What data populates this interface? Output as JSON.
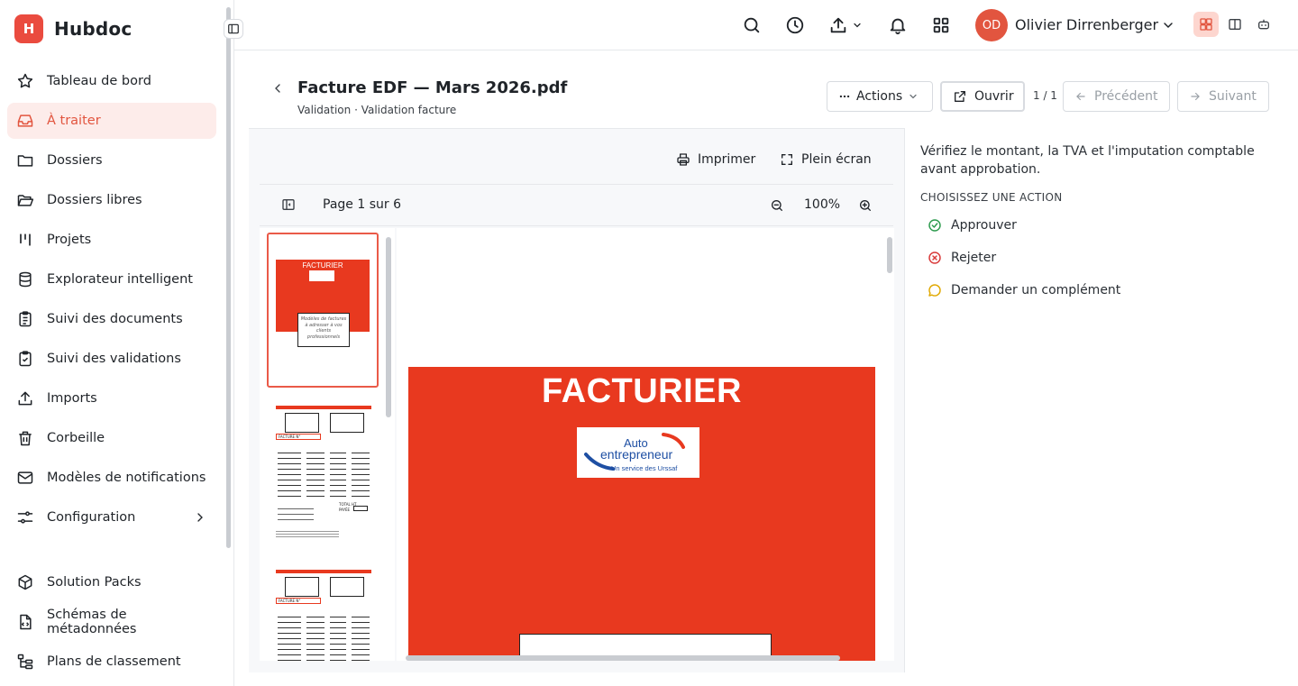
{
  "app": {
    "name": "Hubdoc",
    "logo_letter": "H"
  },
  "sidebar": {
    "items": [
      {
        "label": "Tableau de bord",
        "icon": "star-icon"
      },
      {
        "label": "À traiter",
        "icon": "inbox-icon",
        "active": true
      },
      {
        "label": "Dossiers",
        "icon": "folder-icon"
      },
      {
        "label": "Dossiers libres",
        "icon": "folder-open-icon"
      },
      {
        "label": "Projets",
        "icon": "kanban-icon"
      },
      {
        "label": "Explorateur intelligent",
        "icon": "database-icon"
      },
      {
        "label": "Suivi des documents",
        "icon": "clipboard-list-icon"
      },
      {
        "label": "Suivi des validations",
        "icon": "clipboard-check-icon"
      },
      {
        "label": "Imports",
        "icon": "upload-icon"
      },
      {
        "label": "Corbeille",
        "icon": "trash-icon"
      },
      {
        "label": "Modèles de notifications",
        "icon": "mail-icon"
      },
      {
        "label": "Configuration",
        "icon": "settings-sliders-icon"
      }
    ],
    "secondary_items": [
      {
        "label": "Solution Packs",
        "icon": "package-icon"
      },
      {
        "label": "Schémas de métadonnées",
        "icon": "file-code-icon"
      },
      {
        "label": "Plans de classement",
        "icon": "tree-icon"
      }
    ]
  },
  "topbar": {
    "user": {
      "initials": "OD",
      "name": "Olivier Dirrenberger"
    }
  },
  "document": {
    "title": "Facture EDF — Mars 2026.pdf",
    "subtitle": "Validation · Validation facture",
    "actions_label": "Actions",
    "open_label": "Ouvrir",
    "counter": "1 / 1",
    "prev_label": "Précédent",
    "next_label": "Suivant"
  },
  "viewer": {
    "print_label": "Imprimer",
    "fullscreen_label": "Plein écran",
    "page_label": "Page 1 sur 6",
    "zoom": "100%",
    "page_title": "FACTURIER",
    "logo_line1": "Auto",
    "logo_line2": "entrepreneur",
    "logo_line3": "Un service des Urssaf",
    "thumb_title": "FACTURIER",
    "thumb_caption": "Modèles de factures à adresser à vos clients professionnels",
    "thumb_facture": "FACTURE N°",
    "thumb_total": "TOTAL HT",
    "thumb_payee": "PAYÉE"
  },
  "panel": {
    "instruction": "Vérifiez le montant, la TVA et l'imputation comptable avant approbation.",
    "heading": "CHOISISSEZ UNE ACTION",
    "actions": [
      {
        "label": "Approuver",
        "color": "#2e9b4f"
      },
      {
        "label": "Rejeter",
        "color": "#d93a3a"
      },
      {
        "label": "Demander un complément",
        "color": "#e0a800"
      }
    ]
  },
  "colors": {
    "brand": "#ea4b3f",
    "active_bg": "#fdecea",
    "page_red": "#e8391f"
  }
}
